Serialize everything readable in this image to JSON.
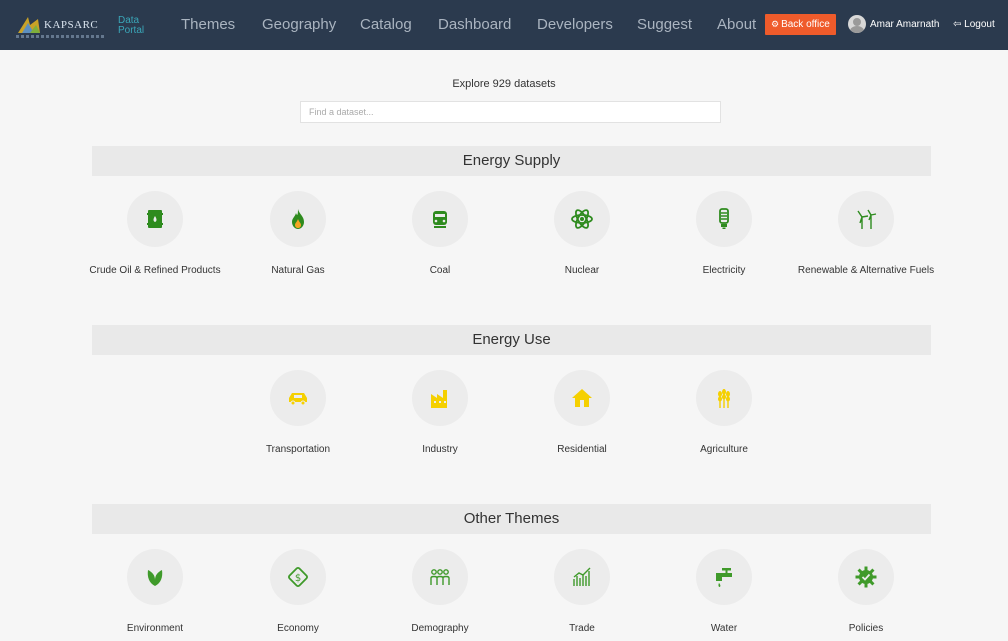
{
  "nav": {
    "logo_text": "KAPSARC",
    "portal_label": "Data Portal",
    "items": [
      "Themes",
      "Geography",
      "Catalog",
      "Dashboard",
      "Developers",
      "Suggest",
      "About"
    ],
    "back_office": "Back office",
    "user_name": "Amar Amarnath",
    "logout": "Logout"
  },
  "explore": {
    "title": "Explore 929 datasets",
    "search_placeholder": "Find a dataset..."
  },
  "colors": {
    "nav_bg": "#2b3a4e",
    "back_office": "#ef5b2b",
    "supply_green": "#2e8b1e",
    "use_yellow": "#f5d000",
    "other_green": "#3f9a2a"
  },
  "sections": [
    {
      "title": "Energy Supply",
      "themes": [
        {
          "label": "Crude Oil & Refined Products",
          "icon": "oil-barrel-icon"
        },
        {
          "label": "Natural Gas",
          "icon": "flame-icon"
        },
        {
          "label": "Coal",
          "icon": "coal-wagon-icon"
        },
        {
          "label": "Nuclear",
          "icon": "atom-icon"
        },
        {
          "label": "Electricity",
          "icon": "light-bulb-icon"
        },
        {
          "label": "Renewable & Alternative Fuels",
          "icon": "wind-turbine-icon"
        }
      ]
    },
    {
      "title": "Energy Use",
      "themes": [
        {
          "label": "Transportation",
          "icon": "car-icon"
        },
        {
          "label": "Industry",
          "icon": "factory-icon"
        },
        {
          "label": "Residential",
          "icon": "house-icon"
        },
        {
          "label": "Agriculture",
          "icon": "wheat-icon"
        }
      ]
    },
    {
      "title": "Other Themes",
      "themes": [
        {
          "label": "Environment",
          "icon": "leaf-icon"
        },
        {
          "label": "Economy",
          "icon": "money-icon"
        },
        {
          "label": "Demography",
          "icon": "people-icon"
        },
        {
          "label": "Trade",
          "icon": "bar-chart-icon"
        },
        {
          "label": "Water",
          "icon": "water-tap-icon"
        },
        {
          "label": "Policies",
          "icon": "gear-icon"
        }
      ]
    }
  ]
}
